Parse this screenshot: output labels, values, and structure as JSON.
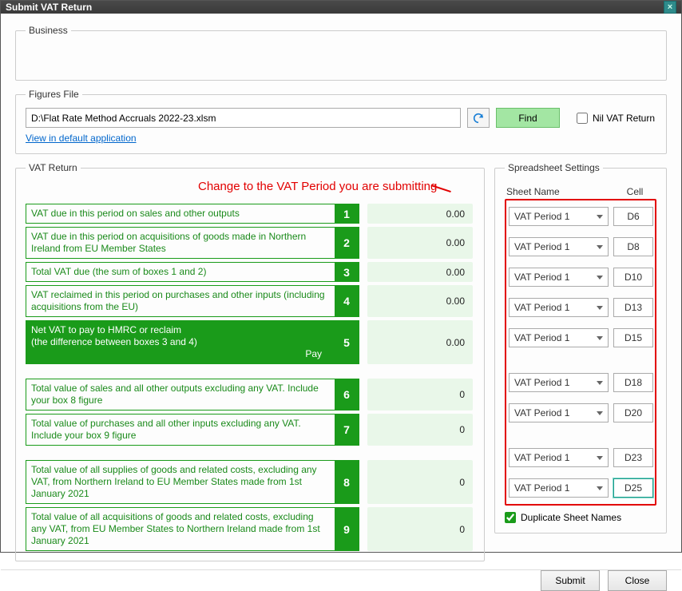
{
  "window": {
    "title": "Submit VAT Return"
  },
  "business": {
    "legend": "Business"
  },
  "figures": {
    "legend": "Figures File",
    "path": "D:\\Flat Rate Method Accruals 2022-23.xlsm",
    "find_label": "Find",
    "nil_label": "Nil VAT Return",
    "link_label": "View in default application"
  },
  "vat": {
    "legend": "VAT Return",
    "annotation": "Change to the VAT Period you are submitting",
    "rows": [
      {
        "desc": "VAT due in this period on sales and other outputs",
        "num": "1",
        "value": "0.00"
      },
      {
        "desc": "VAT due in this period on acquisitions of goods made in Northern Ireland from EU Member States",
        "num": "2",
        "value": "0.00"
      },
      {
        "desc": "Total VAT due (the sum of boxes 1 and 2)",
        "num": "3",
        "value": "0.00"
      },
      {
        "desc": "VAT reclaimed in this period on purchases and other inputs (including acquisitions from the EU)",
        "num": "4",
        "value": "0.00"
      },
      {
        "desc": "Net VAT to pay to HMRC or reclaim\n(the difference between boxes 3 and 4)",
        "num": "5",
        "value": "0.00",
        "pay": "Pay",
        "total": true
      },
      {
        "desc": "Total value of sales and all other outputs excluding any VAT. Include your box 8 figure",
        "num": "6",
        "value": "0"
      },
      {
        "desc": "Total value of purchases and all other inputs excluding any VAT. Include your box 9 figure",
        "num": "7",
        "value": "0"
      },
      {
        "desc": "Total value of all supplies of goods and related costs, excluding any VAT, from Northern Ireland to EU Member States made from 1st January 2021",
        "num": "8",
        "value": "0"
      },
      {
        "desc": "Total value of all acquisitions of goods and related costs, excluding any VAT, from EU Member States to Northern Ireland made from 1st January 2021",
        "num": "9",
        "value": "0"
      }
    ]
  },
  "ss": {
    "legend": "Spreadsheet Settings",
    "sheet_header": "Sheet Name",
    "cell_header": "Cell",
    "rows": [
      {
        "sheet": "VAT Period 1",
        "cell": "D6"
      },
      {
        "sheet": "VAT Period 1",
        "cell": "D8"
      },
      {
        "sheet": "VAT Period 1",
        "cell": "D10"
      },
      {
        "sheet": "VAT Period 1",
        "cell": "D13"
      },
      {
        "sheet": "VAT Period 1",
        "cell": "D15"
      },
      {
        "sheet": "VAT Period 1",
        "cell": "D18"
      },
      {
        "sheet": "VAT Period 1",
        "cell": "D20"
      },
      {
        "sheet": "VAT Period 1",
        "cell": "D23"
      },
      {
        "sheet": "VAT Period 1",
        "cell": "D25",
        "focus": true
      }
    ],
    "dup_label": "Duplicate Sheet Names",
    "dup_checked": true
  },
  "footer": {
    "submit": "Submit",
    "close": "Close"
  }
}
